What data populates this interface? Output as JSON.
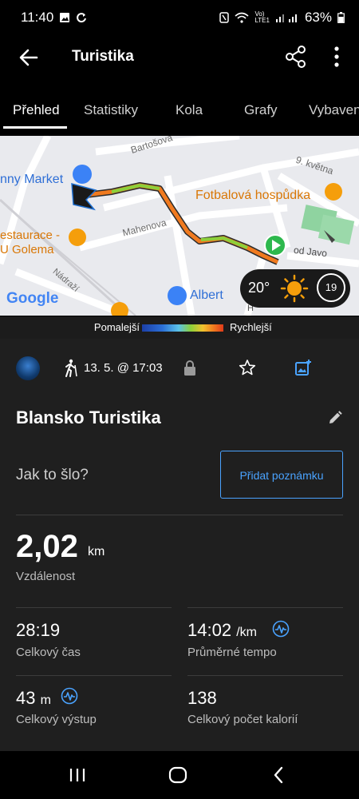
{
  "status": {
    "time": "11:40",
    "battery": "63%"
  },
  "appbar": {
    "title": "Turistika"
  },
  "tabs": [
    "Přehled",
    "Statistiky",
    "Kola",
    "Grafy",
    "Vybaven"
  ],
  "map": {
    "labels": {
      "bartosova": "Bartošova",
      "kvetna": "9. května",
      "market": "nny Market",
      "fotbalova": "Fotbalová hospůdka",
      "restaurace1": "estaurace -",
      "restaurace2": "U Golema",
      "mahenova": "Mahenova",
      "nadrazi": "Nádraží",
      "albert": "Albert",
      "podjavo": "od Javo",
      "google": "Google",
      "h": "H"
    },
    "weather": {
      "temp": "20°",
      "wind": "19"
    }
  },
  "legend": {
    "slower": "Pomalejší",
    "faster": "Rychlejší"
  },
  "activity": {
    "date": "13. 5. @ 17:03",
    "title": "Blansko Turistika",
    "how": "Jak to šlo?",
    "add_note": "Přidat poznámku",
    "distance": {
      "value": "2,02",
      "unit": "km",
      "label": "Vzdálenost"
    },
    "time": {
      "value": "28:19",
      "label": "Celkový čas"
    },
    "pace": {
      "value": "14:02",
      "unit": "/km",
      "label": "Průměrné tempo"
    },
    "ascent": {
      "value": "43",
      "unit": "m",
      "label": "Celkový výstup"
    },
    "calories": {
      "value": "138",
      "label": "Celkový počet kalorií"
    }
  },
  "colors": {
    "accent": "#4aa3ff",
    "background": "#1f1f1f",
    "start": "#2db84d"
  },
  "icons": [
    "back-arrow-icon",
    "share-icon",
    "more-vert-icon",
    "hiking-icon",
    "lock-icon",
    "star-icon",
    "add-photo-icon",
    "edit-pencil-icon",
    "pulse-icon",
    "recents-icon",
    "home-icon",
    "back-nav-icon"
  ]
}
